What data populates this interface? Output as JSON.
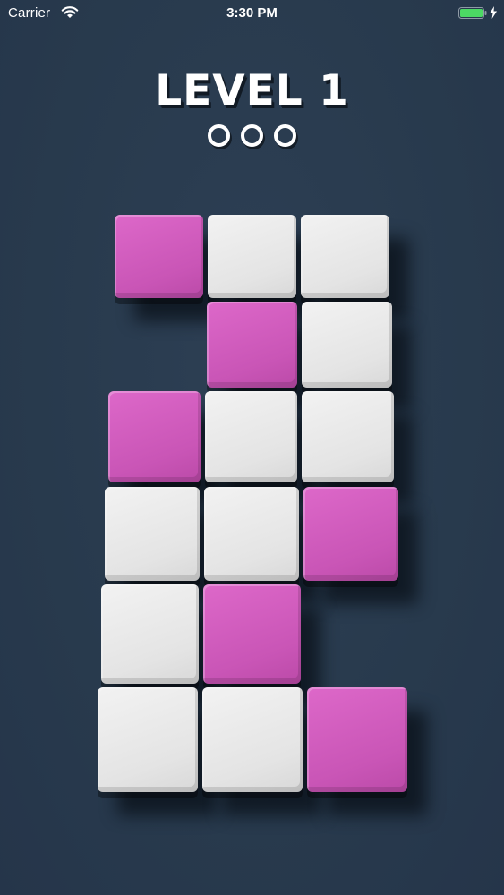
{
  "status_bar": {
    "carrier": "Carrier",
    "time": "3:30 PM",
    "battery_color": "#4cd964"
  },
  "header": {
    "title": "LEVEL 1",
    "progress_dots": 3
  },
  "board": {
    "colors": {
      "white": "#e6e6e6",
      "pink": "#cc5ab9",
      "background": "#2a3b4f"
    },
    "rows": [
      [
        "pink",
        "white",
        "white"
      ],
      [
        null,
        "pink",
        "white"
      ],
      [
        "pink",
        "white",
        "white"
      ],
      [
        "white",
        "white",
        "pink"
      ],
      [
        "white",
        "pink",
        null
      ],
      [
        "white",
        "white",
        "pink"
      ]
    ]
  }
}
